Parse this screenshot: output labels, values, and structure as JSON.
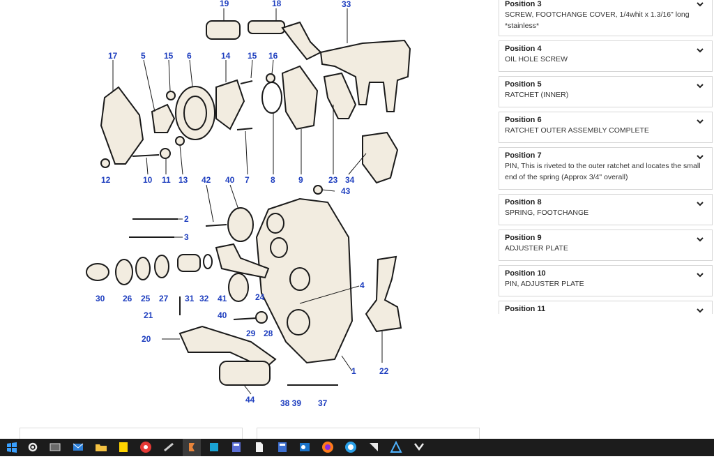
{
  "diagram": {
    "callouts": [
      "19",
      "18",
      "33",
      "17",
      "5",
      "15",
      "6",
      "14",
      "15",
      "16",
      "12",
      "10",
      "11",
      "13",
      "42",
      "40",
      "7",
      "8",
      "9",
      "23",
      "34",
      "43",
      "2",
      "3",
      "30",
      "26",
      "25",
      "27",
      "31",
      "32",
      "24",
      "41",
      "40",
      "21",
      "4",
      "29",
      "28",
      "20",
      "22",
      "1",
      "44",
      "38 39",
      "37"
    ]
  },
  "positions": [
    {
      "title": "Position 3",
      "desc": "SCREW, FOOTCHANGE COVER, 1/4whit x 1.3/16\" long *stainless*"
    },
    {
      "title": "Position 4",
      "desc": "OIL HOLE SCREW"
    },
    {
      "title": "Position 5",
      "desc": "RATCHET (INNER)"
    },
    {
      "title": "Position 6",
      "desc": "RATCHET OUTER ASSEMBLY COMPLETE"
    },
    {
      "title": "Position 7",
      "desc": "PIN, This is riveted to the outer ratchet and locates the small end of the spring (Approx 3/4\" overall)"
    },
    {
      "title": "Position 8",
      "desc": "SPRING, FOOTCHANGE"
    },
    {
      "title": "Position 9",
      "desc": "ADJUSTER PLATE"
    },
    {
      "title": "Position 10",
      "desc": "PIN, ADJUSTER PLATE"
    },
    {
      "title": "Position 11",
      "desc": ""
    }
  ],
  "taskbar": {
    "icons": [
      "start-icon",
      "settings-icon",
      "task-view-icon",
      "mail-icon",
      "file-explorer-icon",
      "sticky-notes-icon",
      "chrome-icon",
      "app-icon",
      "app-active-icon",
      "app-icon",
      "calculator-icon",
      "document-icon",
      "calculator-icon",
      "outlook-icon",
      "firefox-icon",
      "edge-icon",
      "app-icon",
      "app-icon",
      "app-icon"
    ]
  },
  "colors": {
    "callout": "#1f3fbf",
    "taskbar": "#1c1c1c"
  }
}
